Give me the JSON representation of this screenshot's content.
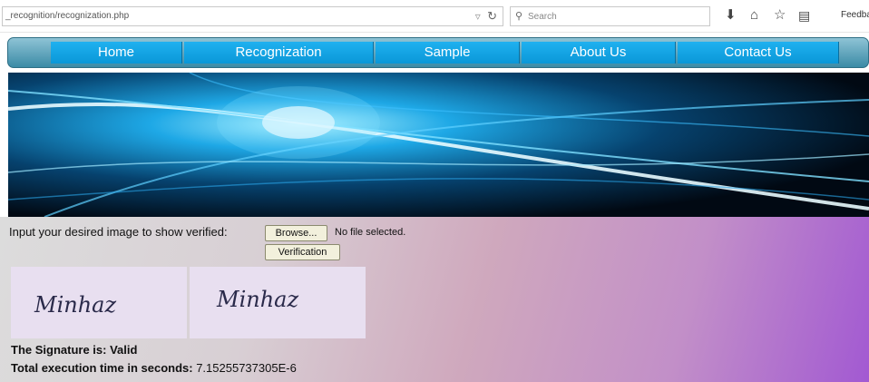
{
  "browser": {
    "url": "_recognition/recognization.php",
    "search_placeholder": "Search",
    "feedback_label": "Feedba",
    "icons": [
      "dropdown-arrow-icon",
      "reload-icon",
      "search-icon",
      "download-icon",
      "home-icon",
      "bookmark-star-icon",
      "reading-list-icon"
    ]
  },
  "nav": {
    "items": [
      {
        "label": "Home"
      },
      {
        "label": "Recognization"
      },
      {
        "label": "Sample"
      },
      {
        "label": "About Us"
      },
      {
        "label": "Contact Us"
      }
    ]
  },
  "form": {
    "prompt": "Input your desired image to show verified:",
    "browse_label": "Browse...",
    "file_status": "No file selected.",
    "verify_label": "Verification"
  },
  "signatures": [
    {
      "text": "Minhaz"
    },
    {
      "text": "Minhaz"
    }
  ],
  "result": {
    "signature_label": "The Signature is:",
    "signature_value": "Valid",
    "time_label": "Total execution time in seconds:",
    "time_value": "7.15255737305E-6"
  },
  "colors": {
    "nav_button": "#0a97d8",
    "nav_bar": "#3b8ba6",
    "button_face": "#f2f0dc",
    "content_gradient_end": "#a259d2"
  }
}
